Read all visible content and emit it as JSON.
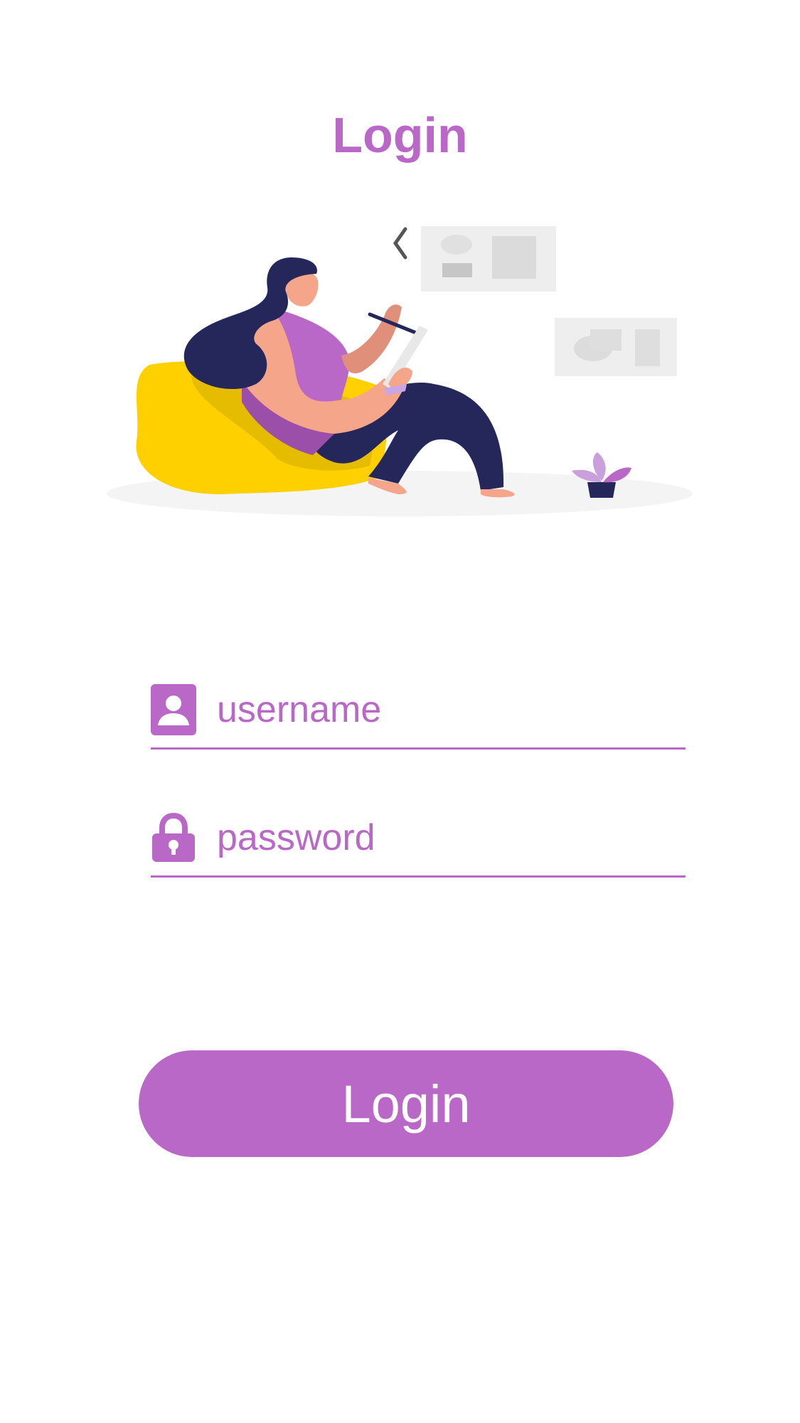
{
  "header": {
    "title": "Login"
  },
  "form": {
    "username": {
      "placeholder": "username",
      "value": "",
      "icon": "user-icon"
    },
    "password": {
      "placeholder": "password",
      "value": "",
      "icon": "lock-icon"
    },
    "submit_label": "Login"
  },
  "colors": {
    "accent": "#BA68C8",
    "background": "#FFFFFF",
    "illustration_yellow": "#FFD000",
    "illustration_navy": "#25275A",
    "illustration_skin": "#F4A58A"
  }
}
